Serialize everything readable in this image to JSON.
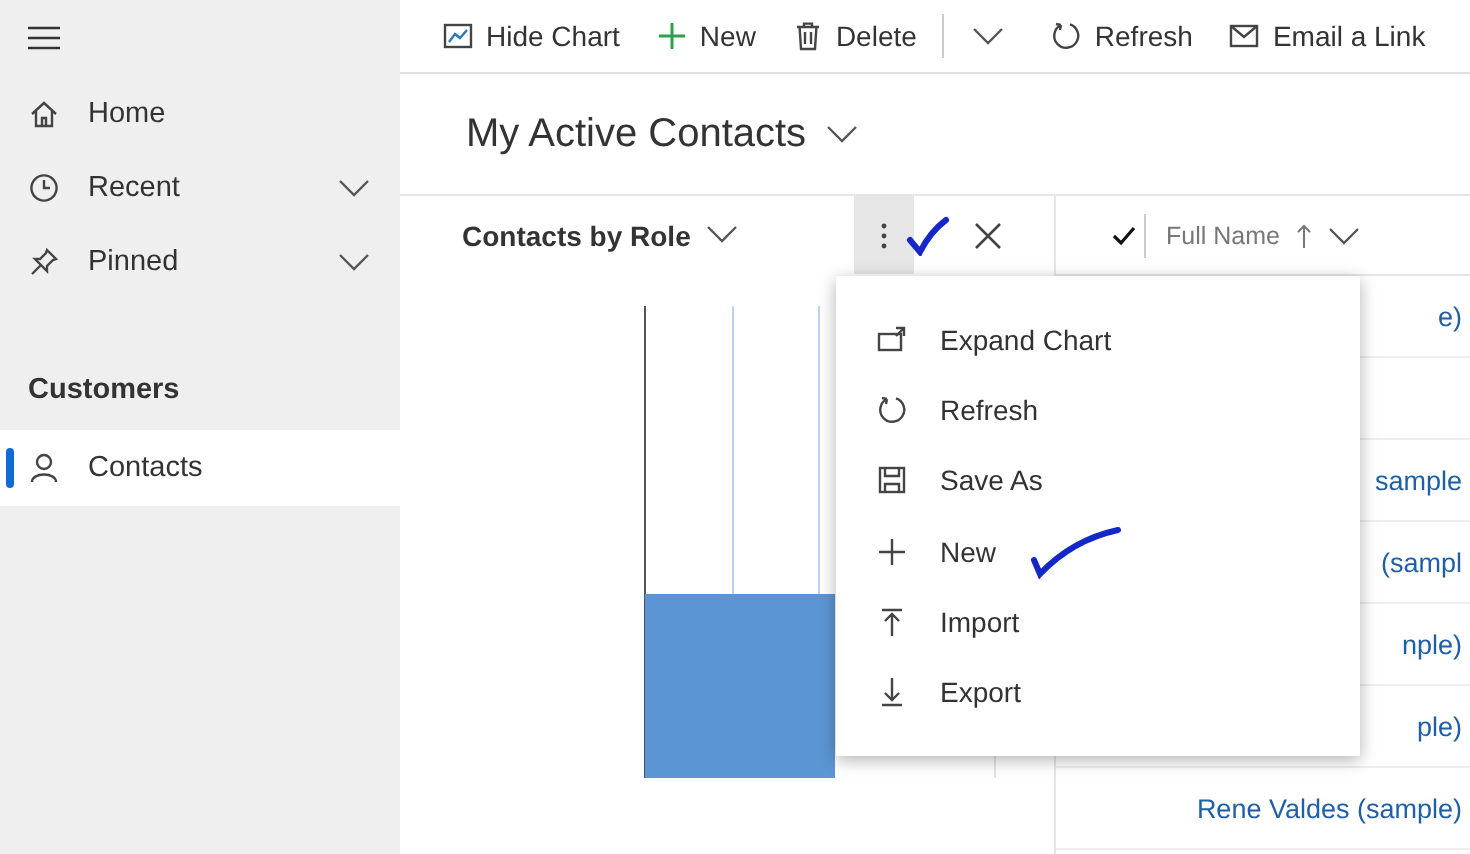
{
  "sidebar": {
    "items": [
      {
        "label": "Home",
        "expandable": false
      },
      {
        "label": "Recent",
        "expandable": true
      },
      {
        "label": "Pinned",
        "expandable": true
      }
    ],
    "section": "Customers",
    "section_items": [
      {
        "label": "Contacts",
        "selected": true
      }
    ]
  },
  "command_bar": {
    "items": [
      {
        "label": "Hide Chart"
      },
      {
        "label": "New"
      },
      {
        "label": "Delete"
      },
      {
        "label": "Refresh"
      },
      {
        "label": "Email a Link"
      }
    ]
  },
  "view": {
    "title": "My Active Contacts"
  },
  "chart": {
    "title": "Contacts by Role"
  },
  "grid": {
    "columns": [
      {
        "label": "Full Name",
        "sorted_ascending": true
      }
    ],
    "rows": [
      {
        "full_name": "e)"
      },
      {},
      {
        "full_name": "sample"
      },
      {
        "full_name": "(sampl"
      },
      {
        "full_name": "nple)"
      },
      {
        "full_name": "ple)"
      },
      {
        "full_name": "Rene Valdes (sample)"
      }
    ]
  },
  "menu": {
    "items": [
      {
        "label": "Expand Chart"
      },
      {
        "label": "Refresh"
      },
      {
        "label": "Save As"
      },
      {
        "label": "New"
      },
      {
        "label": "Import"
      },
      {
        "label": "Export"
      }
    ]
  }
}
